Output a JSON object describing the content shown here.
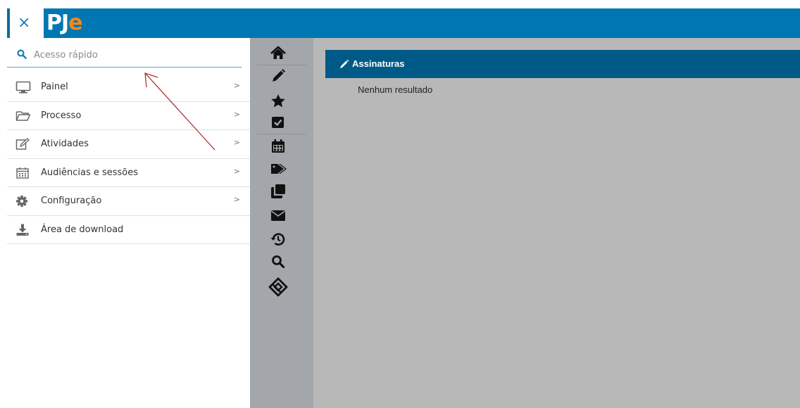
{
  "header": {
    "close_glyph": "×",
    "logo_pj": "PJ",
    "logo_e": "e",
    "bar_color": "#0077b3",
    "accent_color": "#f08a1d"
  },
  "search": {
    "placeholder": "Acesso rápido",
    "value": ""
  },
  "menu": {
    "items": [
      {
        "label": "Painel",
        "icon": "monitor-icon",
        "has_chevron": true
      },
      {
        "label": "Processo",
        "icon": "folder-open-icon",
        "has_chevron": true
      },
      {
        "label": "Atividades",
        "icon": "edit-icon",
        "has_chevron": true
      },
      {
        "label": "Audiências e sessões",
        "icon": "calendar-icon",
        "has_chevron": true
      },
      {
        "label": "Configuração",
        "icon": "gear-icon",
        "has_chevron": true
      },
      {
        "label": "Área de download",
        "icon": "download-icon",
        "has_chevron": false
      }
    ],
    "chevron": ">"
  },
  "rail": {
    "icons": [
      "home-icon",
      "pencil-icon",
      "star-icon",
      "check-square-icon",
      "calendar-icon",
      "tags-icon",
      "clone-icon",
      "envelope-icon",
      "history-icon",
      "search-icon",
      "pje-office-icon"
    ]
  },
  "panel": {
    "title": "Assinaturas",
    "empty_text": "Nenhum resultado",
    "header_color": "#005a87"
  },
  "annotation": {
    "arrow_color": "#b03030"
  }
}
